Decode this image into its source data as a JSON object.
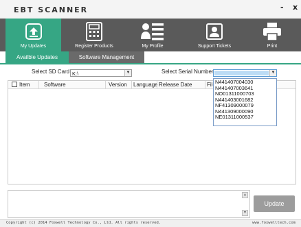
{
  "app": {
    "title": "EBT SCANNER",
    "minimize": "-",
    "close": "x"
  },
  "toolbar": [
    {
      "label": "My Updates",
      "icon": "upload-box-icon"
    },
    {
      "label": "Register Products",
      "icon": "calculator-icon"
    },
    {
      "label": "My Profile",
      "icon": "profile-icon"
    },
    {
      "label": "Support Tickets",
      "icon": "contact-icon"
    },
    {
      "label": "Print",
      "icon": "printer-icon"
    }
  ],
  "tabs": [
    {
      "label": "Availble Updates",
      "active": true
    },
    {
      "label": "Software Management",
      "active": false
    }
  ],
  "sd_card": {
    "label": "Select SD Card",
    "value": "K:\\"
  },
  "serial": {
    "label": "Select Serial Number",
    "value": ""
  },
  "table": {
    "columns": [
      "Item",
      "Software",
      "Version",
      "Language",
      "Release Date",
      "File"
    ]
  },
  "serial_options": [
    "N441407004030",
    "N441407003641",
    "NO01311000703",
    "N441403001682",
    "NF41309000079",
    "N441309000090",
    "NE01311000537"
  ],
  "log": {
    "scroll_up": "▲",
    "scroll_down": "▼"
  },
  "update_button": "Update",
  "status": {
    "copyright": "Copyright (c) 2014 Foxwell Technology Co., Ltd. All rights reserved.",
    "website": "www.foxwelltech.com"
  },
  "colors": {
    "accent": "#36a684",
    "toolbar": "#5a5a5a",
    "tab_inactive": "#6a6a6a",
    "button": "#9c9c9c"
  }
}
